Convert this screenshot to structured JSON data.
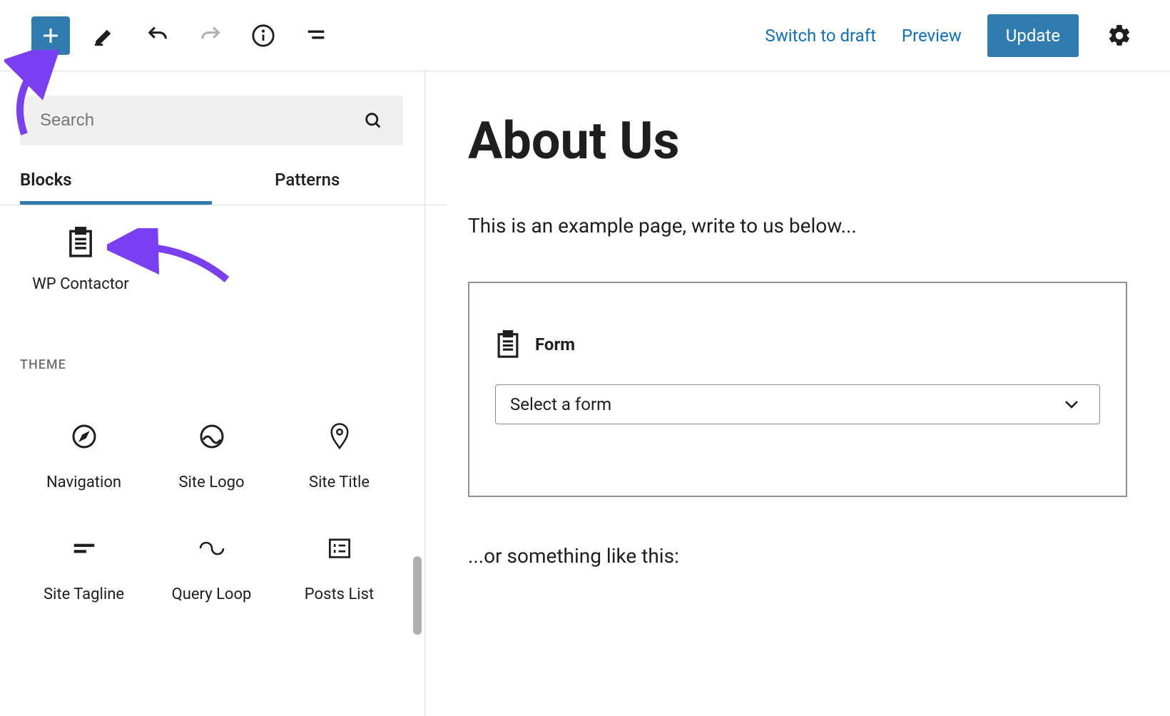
{
  "topbar": {
    "switch_to_draft": "Switch to draft",
    "preview": "Preview",
    "update": "Update"
  },
  "sidebar": {
    "search_placeholder": "Search",
    "tab_blocks": "Blocks",
    "tab_patterns": "Patterns",
    "featured_block": "WP Contactor",
    "theme_heading": "THEME",
    "blocks": [
      {
        "label": "Navigation"
      },
      {
        "label": "Site Logo"
      },
      {
        "label": "Site Title"
      },
      {
        "label": "Site Tagline"
      },
      {
        "label": "Query Loop"
      },
      {
        "label": "Posts List"
      }
    ]
  },
  "canvas": {
    "title": "About Us",
    "body": "This is an example page, write to us below...",
    "form_block_title": "Form",
    "form_select_placeholder": "Select a form",
    "body2": "...or something like this:"
  },
  "colors": {
    "accent": "#307cb1",
    "arrow": "#7b3ff2"
  }
}
